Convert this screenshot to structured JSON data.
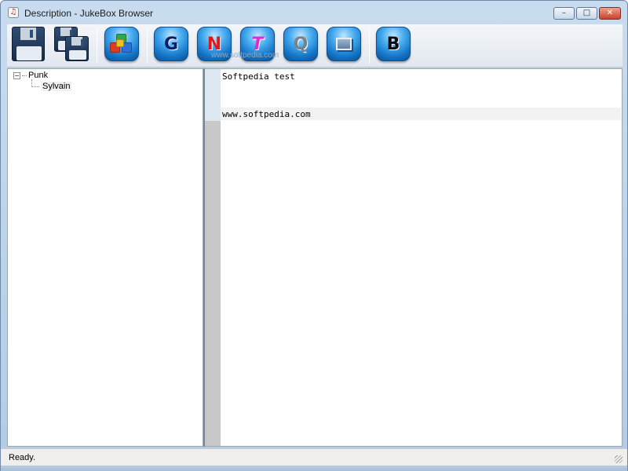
{
  "window": {
    "title": "Description - JukeBox Browser",
    "buttons": {
      "minimize": "–",
      "maximize": "□",
      "close": "✕"
    }
  },
  "toolbar": {
    "watermark": "www.softpedia.com",
    "tools": [
      {
        "id": "save",
        "icon": "floppy-disk-icon"
      },
      {
        "id": "save-all",
        "icon": "double-floppy-icon"
      },
      {
        "id": "cubes",
        "icon": "colored-cubes-icon"
      },
      {
        "id": "g",
        "letter": "G",
        "color": "#0b1f6e"
      },
      {
        "id": "n",
        "letter": "N",
        "color": "#e0161a"
      },
      {
        "id": "t",
        "letter": "T",
        "color": "#e02bd0"
      },
      {
        "id": "q",
        "letter": "Q",
        "color": "#7c8188"
      },
      {
        "id": "picture",
        "icon": "picture-frame-icon"
      },
      {
        "id": "b",
        "letter": "B",
        "color": "#0b0b0b"
      }
    ]
  },
  "tree": {
    "root": {
      "label": "Punk",
      "expander": "−"
    },
    "children": [
      {
        "label": "Sylvain"
      }
    ]
  },
  "editor": {
    "lines": [
      "Softpedia test",
      "",
      "www.softpedia.com"
    ]
  },
  "status": {
    "text": "Ready."
  }
}
